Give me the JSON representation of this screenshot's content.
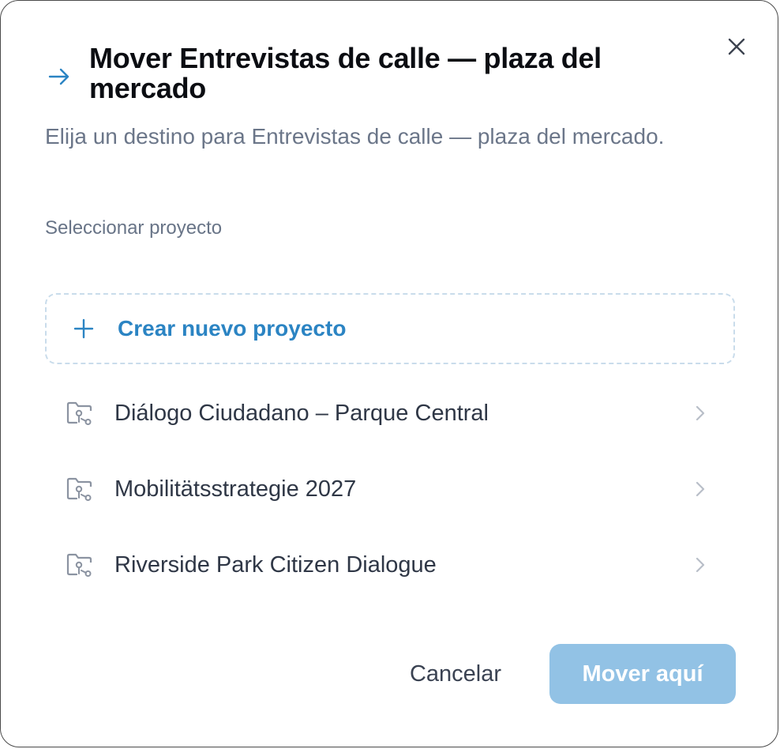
{
  "dialog": {
    "title": "Mover Entrevistas de calle — plaza del mercado",
    "subtitle": "Elija un destino para Entrevistas de calle — plaza del mercado.",
    "section_label": "Seleccionar proyecto",
    "create_label": "Crear nuevo proyecto",
    "projects": [
      {
        "name": "Diálogo Ciudadano – Parque Central"
      },
      {
        "name": "Mobilitätsstrategie 2027"
      },
      {
        "name": "Riverside Park Citizen Dialogue"
      }
    ],
    "cancel_label": "Cancelar",
    "move_label": "Mover aquí"
  },
  "icons": {
    "close": "close-icon",
    "title": "arrow-right-icon",
    "create": "plus-icon",
    "project": "folder-key-icon",
    "row_chevron": "chevron-right-icon"
  },
  "colors": {
    "accent": "#2b84c3",
    "primary_disabled": "#92c2e5",
    "dashed_border": "#c9dceb"
  }
}
